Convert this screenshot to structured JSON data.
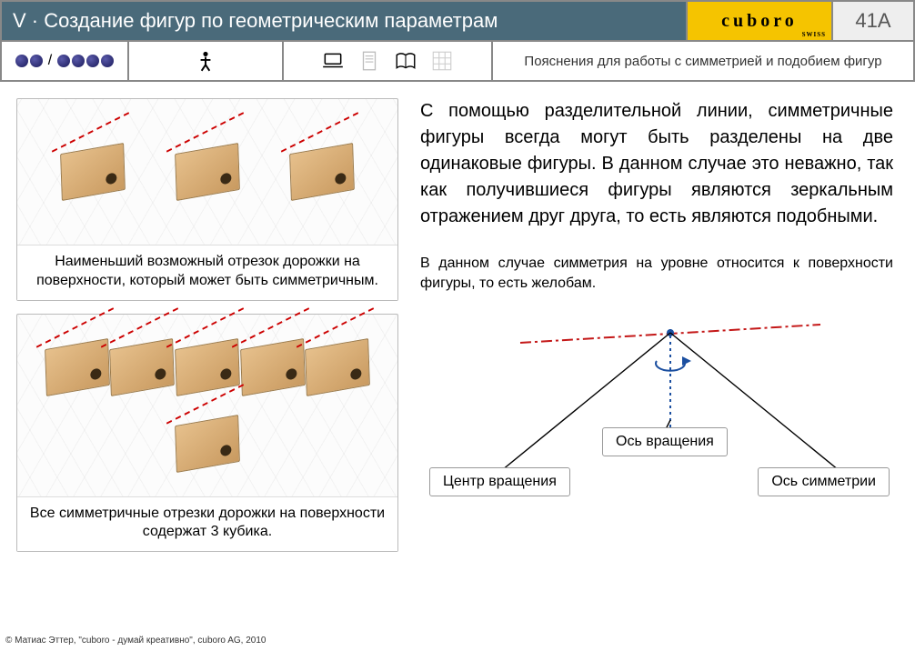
{
  "header": {
    "title": "V · Создание фигур по геометрическим параметрам",
    "logo": "cuboro",
    "logo_sub": "SWISS",
    "page_number": "41A"
  },
  "toolbar": {
    "difficulty_separator": "/",
    "description": "Пояснения для работы с симметрией и подобием фигур"
  },
  "figures": {
    "caption1": "Наименьший возможный отрезок дорожки на поверхности, который может быть симметричным.",
    "caption2": "Все симметричные отрезки дорожки на поверхности содержат 3 кубика."
  },
  "text": {
    "para1": "С помощью разделительной линии, симметричные фигуры всегда могут быть разделены на две одинаковые фигуры. В данном случае это неважно, так как получившиеся фигуры являются зеркальным отражением друг друга, то есть являются подобными.",
    "para2": "В данном случае симметрия на уровне относится к поверхности фигуры, то есть желобам."
  },
  "diagram": {
    "label_center": "Центр вращения",
    "label_rotation_axis": "Ось вращения",
    "label_symmetry_axis": "Ось симметрии"
  },
  "footer": "© Матиас Эттер, \"cuboro - думай креативно\", cuboro AG, 2010"
}
